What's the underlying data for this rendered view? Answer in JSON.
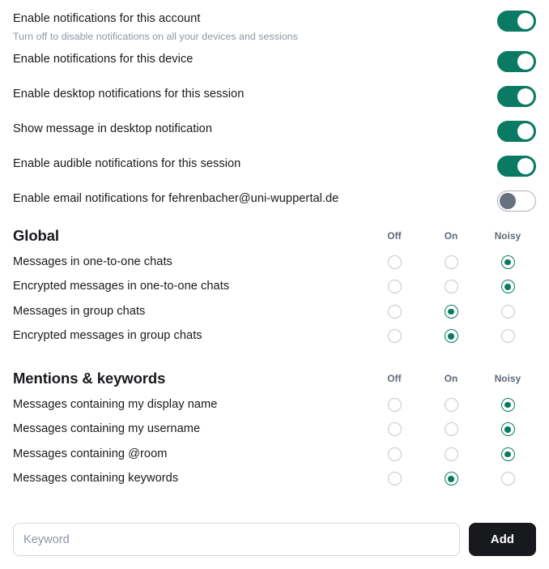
{
  "toggles": [
    {
      "label": "Enable notifications for this account",
      "caption": "Turn off to disable notifications on all your devices and sessions",
      "state": "on"
    },
    {
      "label": "Enable notifications for this device",
      "caption": "",
      "state": "on"
    },
    {
      "label": "Enable desktop notifications for this session",
      "caption": "",
      "state": "on"
    },
    {
      "label": "Show message in desktop notification",
      "caption": "",
      "state": "on"
    },
    {
      "label": "Enable audible notifications for this session",
      "caption": "",
      "state": "on"
    },
    {
      "label": "Enable email notifications for fehrenbacher@uni-wuppertal.de",
      "caption": "",
      "state": "off"
    }
  ],
  "global": {
    "title": "Global",
    "columns": [
      "Off",
      "On",
      "Noisy"
    ],
    "rows": [
      {
        "label": "Messages in one-to-one chats",
        "selected": "Noisy"
      },
      {
        "label": "Encrypted messages in one-to-one chats",
        "selected": "Noisy"
      },
      {
        "label": "Messages in group chats",
        "selected": "On"
      },
      {
        "label": "Encrypted messages in group chats",
        "selected": "On"
      }
    ]
  },
  "mentions": {
    "title": "Mentions & keywords",
    "columns": [
      "Off",
      "On",
      "Noisy"
    ],
    "rows": [
      {
        "label": "Messages containing my display name",
        "selected": "Noisy"
      },
      {
        "label": "Messages containing my username",
        "selected": "Noisy"
      },
      {
        "label": "Messages containing @room",
        "selected": "Noisy"
      },
      {
        "label": "Messages containing keywords",
        "selected": "On"
      }
    ]
  },
  "keyword_form": {
    "placeholder": "Keyword",
    "value": "",
    "add_label": "Add"
  },
  "colors": {
    "accent_green": "#0a7b62",
    "button_dark": "#17191c",
    "text_primary": "#17191c",
    "text_muted": "#8d97a5",
    "column_header": "#5d6779",
    "radio_border": "#c3c8cf",
    "toggle_off_border": "#a9b2bc",
    "toggle_off_knob": "#67717e",
    "input_border": "#d4d8dd"
  }
}
